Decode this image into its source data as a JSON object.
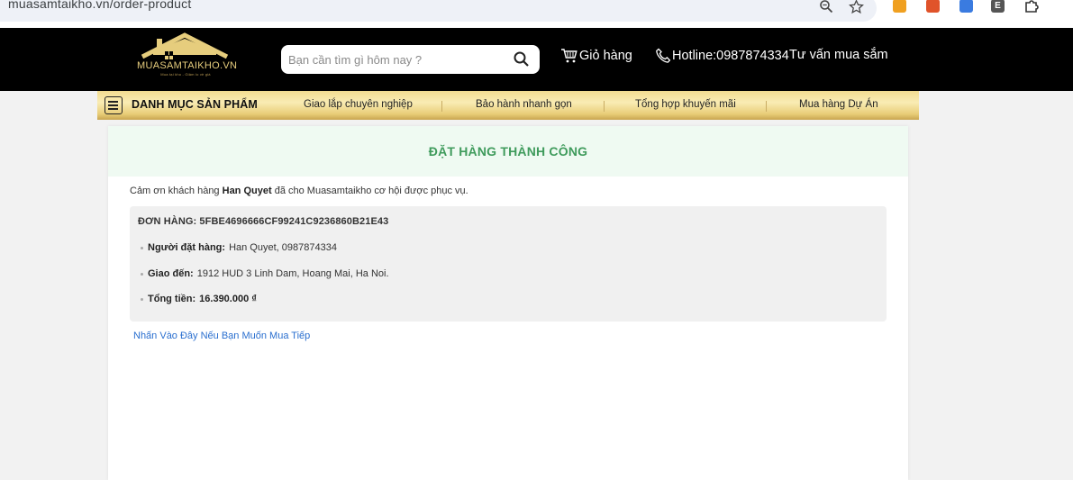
{
  "browser": {
    "url": "muasamtaikho.vn/order-product",
    "icons": [
      "zoom-icon",
      "bookmark-star-icon"
    ],
    "extensions": [
      "extension-icon-1",
      "extension-icon-2",
      "extension-icon-3",
      "extension-icon-e",
      "extensions-puzzle-icon"
    ],
    "ext_e_label": "E"
  },
  "header": {
    "logo_text": "MUASAMTAIKHO.VN",
    "logo_subtext": "Mua tại kho - Giảm lo về giá",
    "search_placeholder": "Bạn cần tìm gì hôm nay ?",
    "cart_label": "Giỏ hàng",
    "hotline_label": "Hotline:0987874334",
    "advice_label": "Tư vấn mua sắm"
  },
  "nav": {
    "category_title": "DANH MỤC SẢN PHẨM",
    "items": [
      {
        "label": "Giao lắp chuyên nghiệp"
      },
      {
        "label": "Bảo hành nhanh gọn"
      },
      {
        "label": "Tổng hợp khuyến mãi"
      },
      {
        "label": "Mua hàng Dự Án"
      }
    ]
  },
  "order": {
    "title": "ĐẶT HÀNG THÀNH CÔNG",
    "thanks_prefix": "Cảm ơn khách hàng",
    "customer_name": "Han Quyet",
    "thanks_suffix": "đã cho Muasamtaikho cơ hội được phục vụ.",
    "order_number": "ĐƠN HÀNG: 5FBE4696666CF99241C9236860B21E43",
    "buyer_label": "Người đặt hàng:",
    "buyer_value": "Han Quyet, 0987874334",
    "ship_label": "Giao đến:",
    "ship_value": "1912 HUD 3 Linh Dam, Hoang Mai, Ha Noi.",
    "total_label": "Tổng tiền:",
    "total_value": "16.390.000 ₫",
    "continue_link": "Nhấn Vào Đây Nếu Bạn Muốn Mua Tiếp"
  },
  "colors": {
    "success_green": "#3f9b5c",
    "link_blue": "#2a6fcf",
    "gold": "#e9cd78"
  }
}
